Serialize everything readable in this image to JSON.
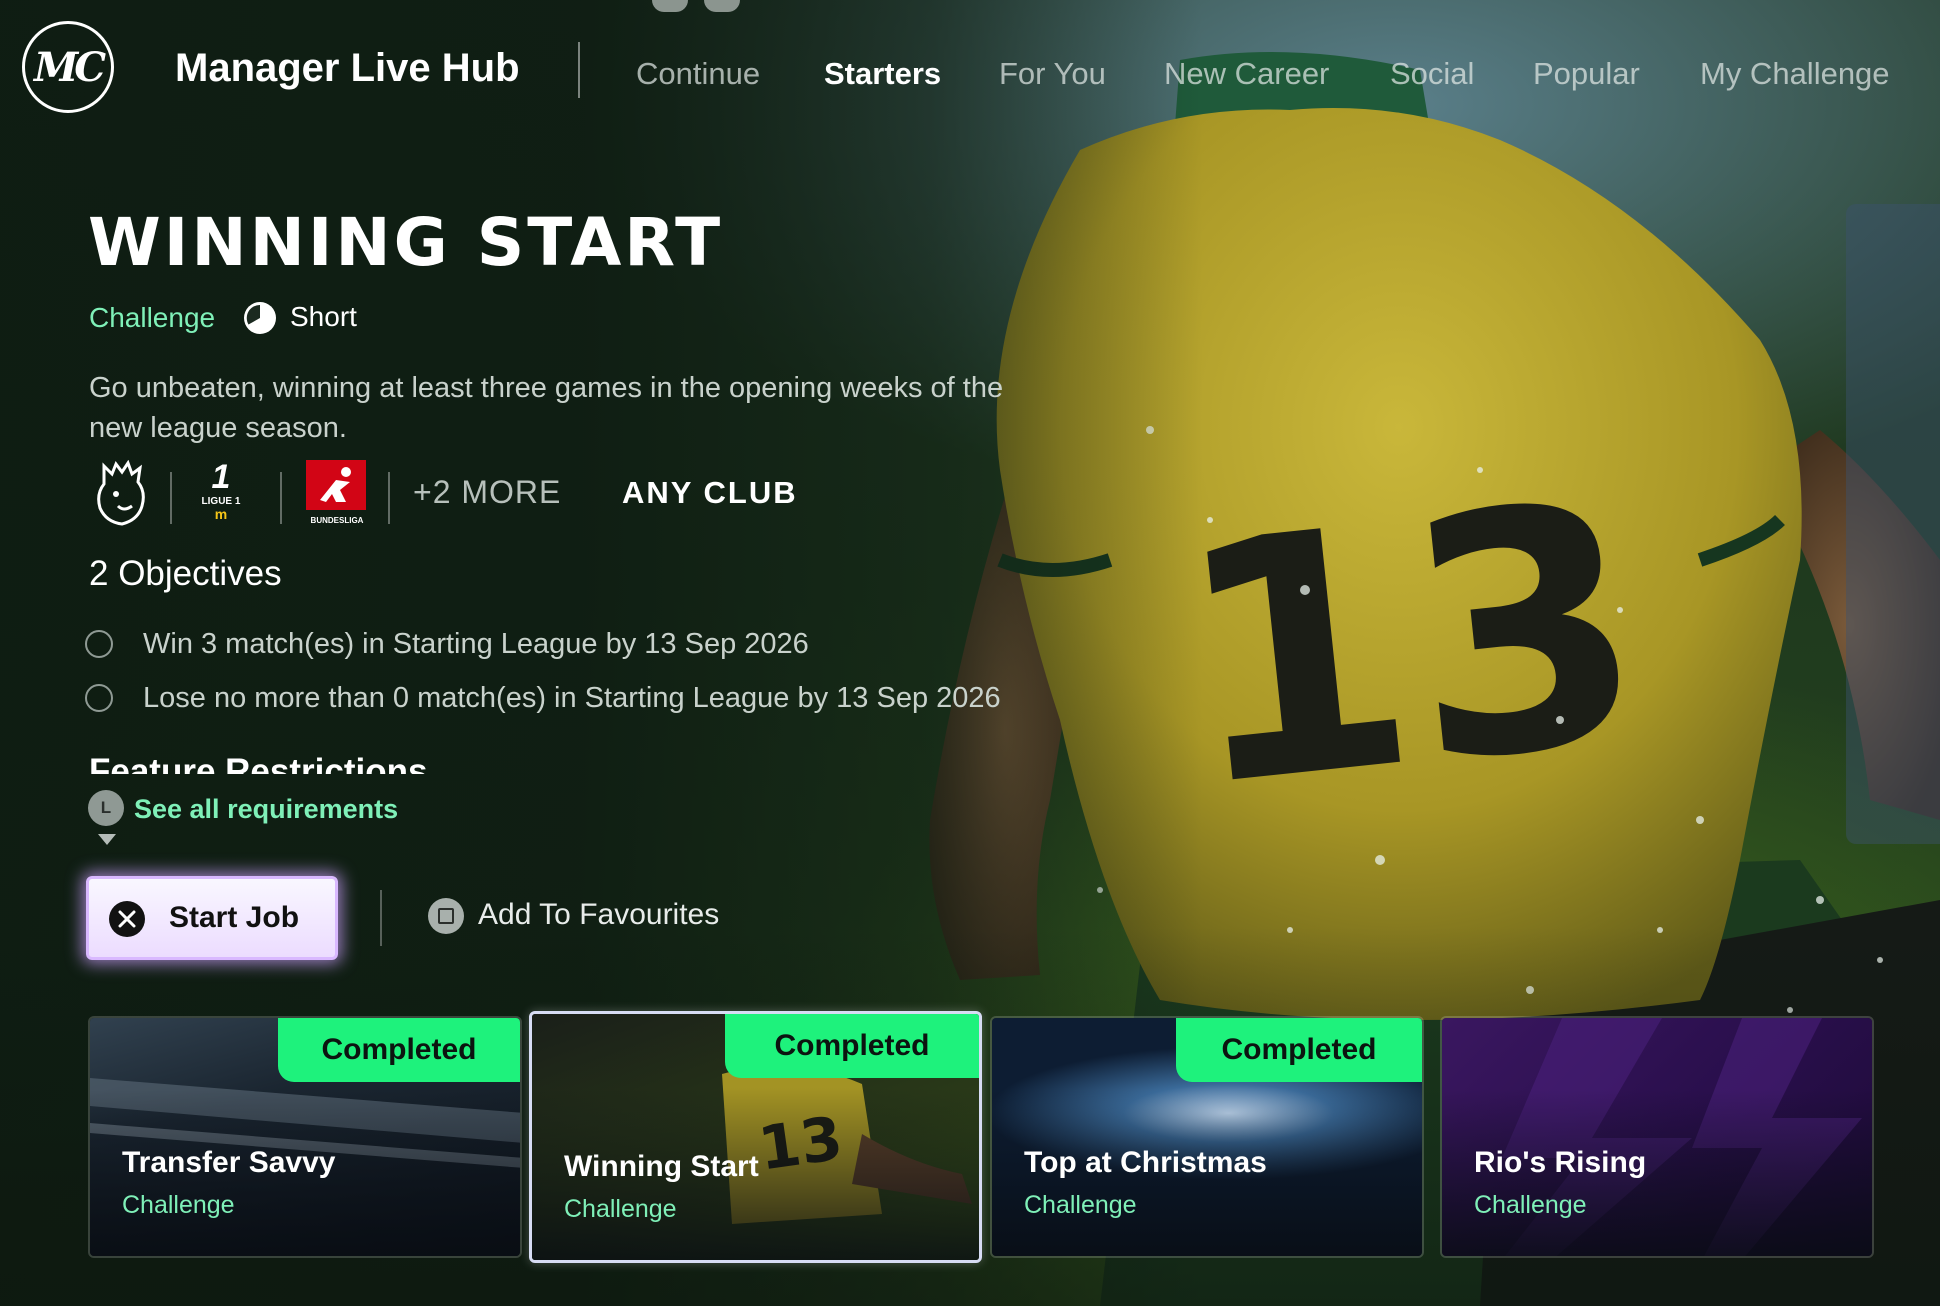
{
  "header": {
    "logo_text": "MC",
    "title": "Manager Live Hub",
    "bumper_left": "LB",
    "bumper_right": "RB",
    "nav": [
      {
        "label": "Continue",
        "active": false
      },
      {
        "label": "Starters",
        "active": true
      },
      {
        "label": "For You",
        "active": false
      },
      {
        "label": "New Career",
        "active": false
      },
      {
        "label": "Social",
        "active": false
      },
      {
        "label": "Popular",
        "active": false
      },
      {
        "label": "My Challenge",
        "active": false
      }
    ]
  },
  "detail": {
    "title": "WINNING START",
    "type": "Challenge",
    "length_icon": "clock-icon",
    "length": "Short",
    "description": "Go unbeaten, winning at least three games in the opening weeks of the new league season.",
    "leagues": [
      {
        "icon": "premier-league-lion-icon"
      },
      {
        "icon": "ligue1-logo",
        "text": "LIGUE 1"
      },
      {
        "icon": "bundesliga-logo",
        "text": "BUNDESLIGA"
      }
    ],
    "more_leagues": "+2 MORE",
    "club": "ANY CLUB",
    "objectives_heading": "2 Objectives",
    "objectives": [
      "Win 3 match(es) in Starting League by 13 Sep 2026",
      "Lose no more than 0 match(es) in Starting League by 13 Sep 2026"
    ],
    "feature_restrictions": "Feature Restrictions",
    "see_all_button": "L",
    "see_all": "See all requirements",
    "start_button": "Start Job",
    "favourite_button": "Add To Favourites",
    "player_number": "13"
  },
  "cards": [
    {
      "name": "Transfer Savvy",
      "type": "Challenge",
      "badge": "Completed",
      "selected": false
    },
    {
      "name": "Winning Start",
      "type": "Challenge",
      "badge": "Completed",
      "selected": true
    },
    {
      "name": "Top at Christmas",
      "type": "Challenge",
      "badge": "Completed",
      "selected": false
    },
    {
      "name": "Rio's Rising",
      "type": "Challenge",
      "badge": "",
      "selected": false
    }
  ],
  "colors": {
    "accent_green": "#7ff0b8",
    "badge_green": "#1ef27c",
    "jersey_yellow": "#b8a62a",
    "start_button_glow": "#d9b8ff"
  }
}
